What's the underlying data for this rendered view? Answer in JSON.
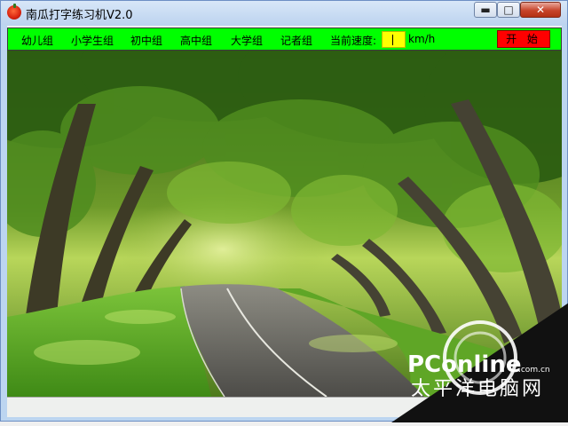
{
  "window": {
    "title": "南瓜打字练习机V2.0",
    "controls": {
      "minimize": "▬",
      "maximize": "□",
      "close": "✕"
    }
  },
  "menubar": {
    "groups": [
      "幼儿组",
      "小学生组",
      "初中组",
      "高中组",
      "大学组",
      "记者组"
    ],
    "speed_label": "当前速度:",
    "speed_value": "",
    "speed_unit": "km/h",
    "start_label": "开 始"
  },
  "watermark": {
    "brand": "PConline",
    "domain": ".com.cn",
    "chinese": "太平洋电脑网"
  },
  "colors": {
    "menubar_bg": "#00ff00",
    "speed_box_bg": "#ffff00",
    "start_button_bg": "#ff0000"
  },
  "icons": {
    "app": "pumpkin-icon",
    "scene": "forest-road-image"
  }
}
